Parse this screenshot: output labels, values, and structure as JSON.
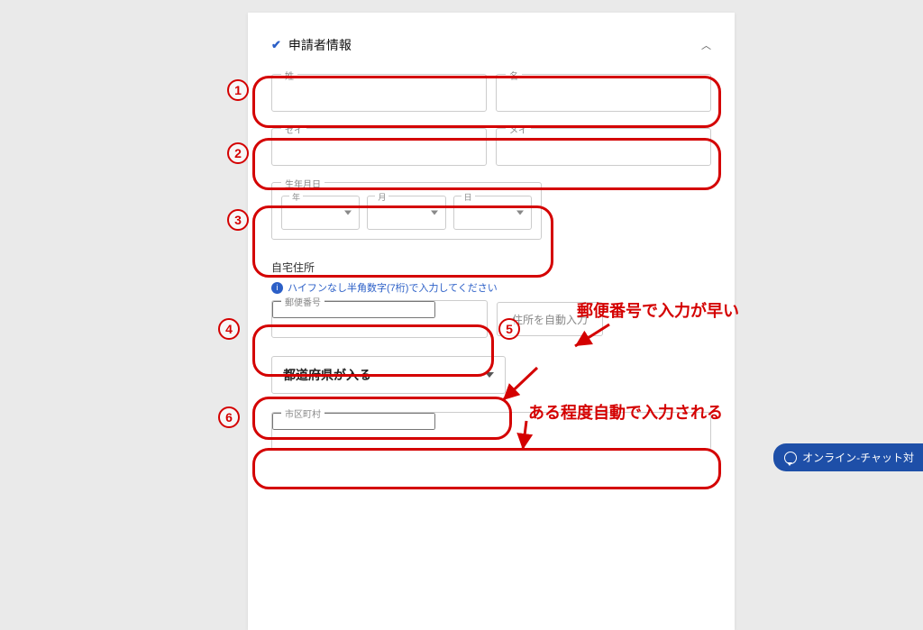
{
  "section": {
    "title": "申請者情報"
  },
  "name": {
    "last_label": "姓",
    "first_label": "名"
  },
  "kana": {
    "last_label": "セイ",
    "first_label": "メイ"
  },
  "birth": {
    "group_label": "生年月日",
    "year_label": "年",
    "month_label": "月",
    "day_label": "日"
  },
  "address": {
    "home_heading": "自宅住所",
    "postal_hint": "ハイフンなし半角数字(7桁)で入力してください",
    "postal_label": "郵便番号",
    "auto_button": "住所を自動入力",
    "pref_placeholder": "都道府県が入る",
    "city_label": "市区町村"
  },
  "annotations": {
    "n1": "1",
    "n2": "2",
    "n3": "3",
    "n4": "4",
    "n5": "5",
    "n6": "6",
    "t1": "郵便番号で入力が早い",
    "t2": "ある程度自動で入力される"
  },
  "chat": {
    "label": "オンライン-チャット対"
  }
}
